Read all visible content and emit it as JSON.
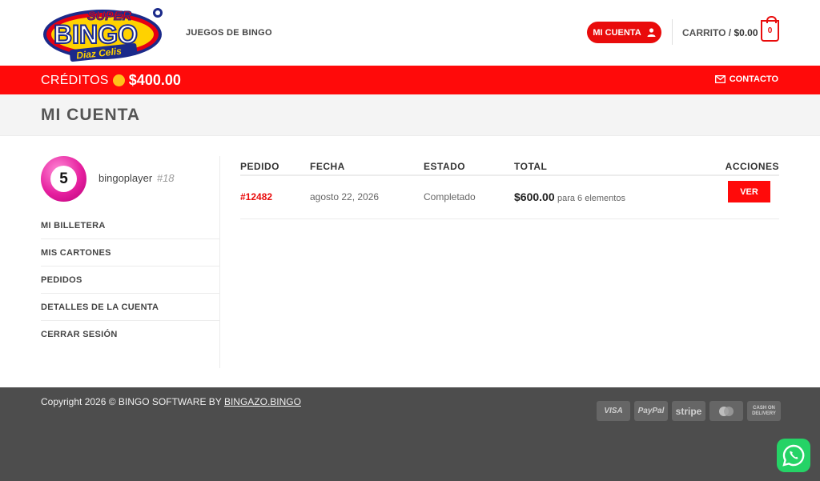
{
  "header": {
    "logo_text": "SUPER BINGO Diaz Celis",
    "nav_games": "JUEGOS DE BINGO",
    "account_label": "MI CUENTA",
    "cart_label": "CARRITO /",
    "cart_amount": "$0.00",
    "cart_count": "0"
  },
  "topbar": {
    "credits_label": "CRÉDITOS",
    "credits_value": "$400.00",
    "contact_label": "CONTACTO"
  },
  "page": {
    "title": "MI CUENTA"
  },
  "sidebar": {
    "avatar_number": "5",
    "username": "bingoplayer",
    "user_id": "#18",
    "items": [
      {
        "label": "MI BILLETERA"
      },
      {
        "label": "MIS CARTONES"
      },
      {
        "label": "PEDIDOS"
      },
      {
        "label": "DETALLES DE LA CUENTA"
      },
      {
        "label": "CERRAR SESIÓN"
      }
    ]
  },
  "orders": {
    "columns": [
      "PEDIDO",
      "FECHA",
      "ESTADO",
      "TOTAL",
      "ACCIONES"
    ],
    "rows": [
      {
        "number": "#12482",
        "date": "agosto 22, 2026",
        "status": "Completado",
        "total": "$600.00",
        "total_note": "para 6 elementos",
        "action": "VER"
      }
    ]
  },
  "footer": {
    "copyright": "Copyright 2026 © BINGO SOFTWARE BY",
    "copyright_link": "BINGAZO.BINGO",
    "payment_methods": [
      "VISA",
      "PayPal",
      "stripe",
      "mastercard",
      "CASH ON DELIVERY"
    ]
  },
  "colors": {
    "accent_red": "#ff0a0a",
    "button_red": "#e90b0b",
    "footer_bg": "#4d4d4d",
    "coin": "#ffc21a",
    "whatsapp": "#25d366"
  }
}
